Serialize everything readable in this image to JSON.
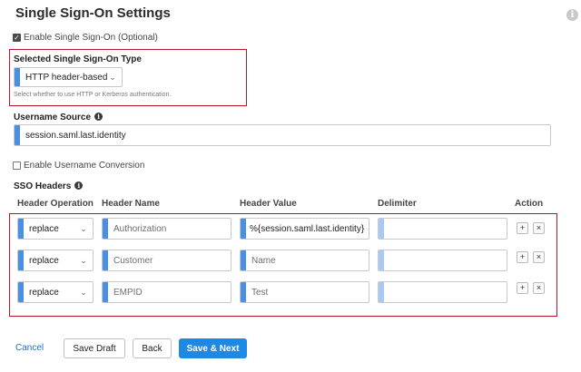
{
  "page": {
    "title": "Single Sign-On Settings",
    "info_icon": "info-icon"
  },
  "enable_sso": {
    "label": "Enable Single Sign-On (Optional)",
    "checked": true
  },
  "sso_type": {
    "label": "Selected Single Sign-On Type",
    "value": "HTTP header-based",
    "hint": "Select whether to use HTTP or Kerberos authentication."
  },
  "username_source": {
    "label": "Username Source",
    "value": "session.saml.last.identity"
  },
  "username_conversion": {
    "label": "Enable Username Conversion",
    "checked": false
  },
  "sso_headers": {
    "label": "SSO Headers",
    "columns": [
      "Header Operation",
      "Header Name",
      "Header Value",
      "Delimiter",
      "Action"
    ],
    "rows": [
      {
        "operation": "replace",
        "name": "Authorization",
        "value": "%{session.saml.last.identity}",
        "delimiter": ""
      },
      {
        "operation": "replace",
        "name": "Customer",
        "value": "Name",
        "delimiter": ""
      },
      {
        "operation": "replace",
        "name": "EMPID",
        "value": "Test",
        "delimiter": ""
      }
    ],
    "add_symbol": "+",
    "remove_symbol": "×"
  },
  "footer": {
    "cancel": "Cancel",
    "save_draft": "Save Draft",
    "back": "Back",
    "save_next": "Save & Next"
  },
  "colors": {
    "accent": "#4a8fe0",
    "primary_button": "#1e88e5",
    "highlight_border": "#b3192b"
  }
}
